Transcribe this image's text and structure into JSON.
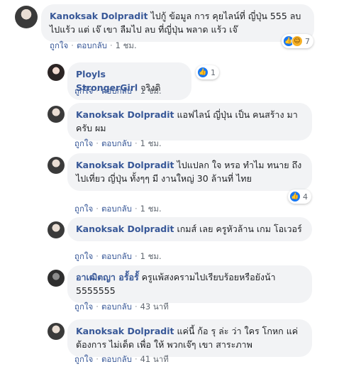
{
  "labels": {
    "like": "ถูกใจ",
    "reply": "ตอบกลับ",
    "dot": "·"
  },
  "comments": [
    {
      "author": "Kanoksak Dolpradit",
      "text": "ไปกู้ ข้อมูล การ คุยไลน์ที่ ญี่ปุ่น 555 ลบ ไปแร้ว แต่ เจ๊ เขา ลืมไป ลบ ที่ญี่ปุ่น พลาด แร้ว เจ๊",
      "time": "1 ชม.",
      "reactions": {
        "icons": [
          "like-icon",
          "haha-icon"
        ],
        "count": "7"
      }
    },
    {
      "author": "Ployls StrongerGirl",
      "text": "จริงดิ",
      "time": "1 ชม.",
      "reactions": {
        "icons": [
          "like-icon"
        ],
        "count": "1"
      }
    },
    {
      "author": "Kanoksak Dolpradit",
      "text": "แอฟไลน์ ญี่ปุ่น เป็น คนสร้าง มา ครับ ผม",
      "time": "1 ชม."
    },
    {
      "author": "Kanoksak Dolpradit",
      "text": "ไปแปลก ใจ หรอ ทำไม ทนาย ถึง ไปเที่ยว ญี่ปุ่น ทั้งๆๆ มี งานใหญ่ 30 ล้านที่ ไทย",
      "time": "1 ชม.",
      "reactions": {
        "icons": [
          "like-icon"
        ],
        "count": "4"
      }
    },
    {
      "author": "Kanoksak Dolpradit",
      "text": "เกมส์ เลย ครูหัวล้าน เกม โอเวอร์",
      "time": "1 ชม."
    },
    {
      "author": "อาเฒิตญา อรั้อรั้",
      "text": "ครูแพ้สงครามไปเรียบร้อยหรือยังน้า 5555555",
      "time": "43 นาที"
    },
    {
      "author": "Kanoksak Dolpradit",
      "text": "แค่นี้ ก้อ รุ ล่ะ ว่า ใคร โกหก แค่ ต้องการ ไม่เด็ด เพื่อ ให้ พวกเจ๊ๆ เขา สาระภาพ",
      "time": "41 นาที"
    }
  ]
}
